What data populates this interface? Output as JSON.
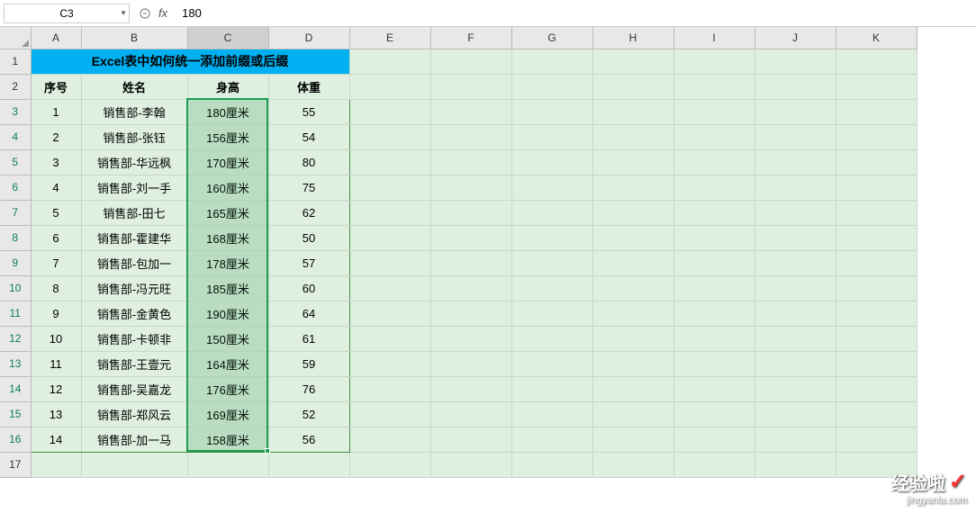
{
  "formula_bar": {
    "cell_ref": "C3",
    "fx_label": "fx",
    "formula_value": "180"
  },
  "columns": [
    "A",
    "B",
    "C",
    "D",
    "E",
    "F",
    "G",
    "H",
    "I",
    "J",
    "K"
  ],
  "row_numbers": [
    1,
    2,
    3,
    4,
    5,
    6,
    7,
    8,
    9,
    10,
    11,
    12,
    13,
    14,
    15,
    16,
    17
  ],
  "title": "Excel表中如何统一添加前缀或后缀",
  "headers": {
    "seq": "序号",
    "name": "姓名",
    "height": "身高",
    "weight": "体重"
  },
  "rows": [
    {
      "seq": "1",
      "name": "销售部-李翰",
      "height": "180厘米",
      "weight": "55"
    },
    {
      "seq": "2",
      "name": "销售部-张钰",
      "height": "156厘米",
      "weight": "54"
    },
    {
      "seq": "3",
      "name": "销售部-华远枫",
      "height": "170厘米",
      "weight": "80"
    },
    {
      "seq": "4",
      "name": "销售部-刘一手",
      "height": "160厘米",
      "weight": "75"
    },
    {
      "seq": "5",
      "name": "销售部-田七",
      "height": "165厘米",
      "weight": "62"
    },
    {
      "seq": "6",
      "name": "销售部-霍建华",
      "height": "168厘米",
      "weight": "50"
    },
    {
      "seq": "7",
      "name": "销售部-包加一",
      "height": "178厘米",
      "weight": "57"
    },
    {
      "seq": "8",
      "name": "销售部-冯元旺",
      "height": "185厘米",
      "weight": "60"
    },
    {
      "seq": "9",
      "name": "销售部-金黄色",
      "height": "190厘米",
      "weight": "64"
    },
    {
      "seq": "10",
      "name": "销售部-卡顿非",
      "height": "150厘米",
      "weight": "61"
    },
    {
      "seq": "11",
      "name": "销售部-王壹元",
      "height": "164厘米",
      "weight": "59"
    },
    {
      "seq": "12",
      "name": "销售部-吴嘉龙",
      "height": "176厘米",
      "weight": "76"
    },
    {
      "seq": "13",
      "name": "销售部-郑风云",
      "height": "169厘米",
      "weight": "52"
    },
    {
      "seq": "14",
      "name": "销售部-加一马",
      "height": "158厘米",
      "weight": "56"
    }
  ],
  "selection": {
    "active_cell": "C3",
    "range_start_row": 3,
    "range_end_row": 16,
    "range_col": "C"
  },
  "watermark": {
    "main": "经验啦",
    "sub": "jingyanla.com"
  }
}
